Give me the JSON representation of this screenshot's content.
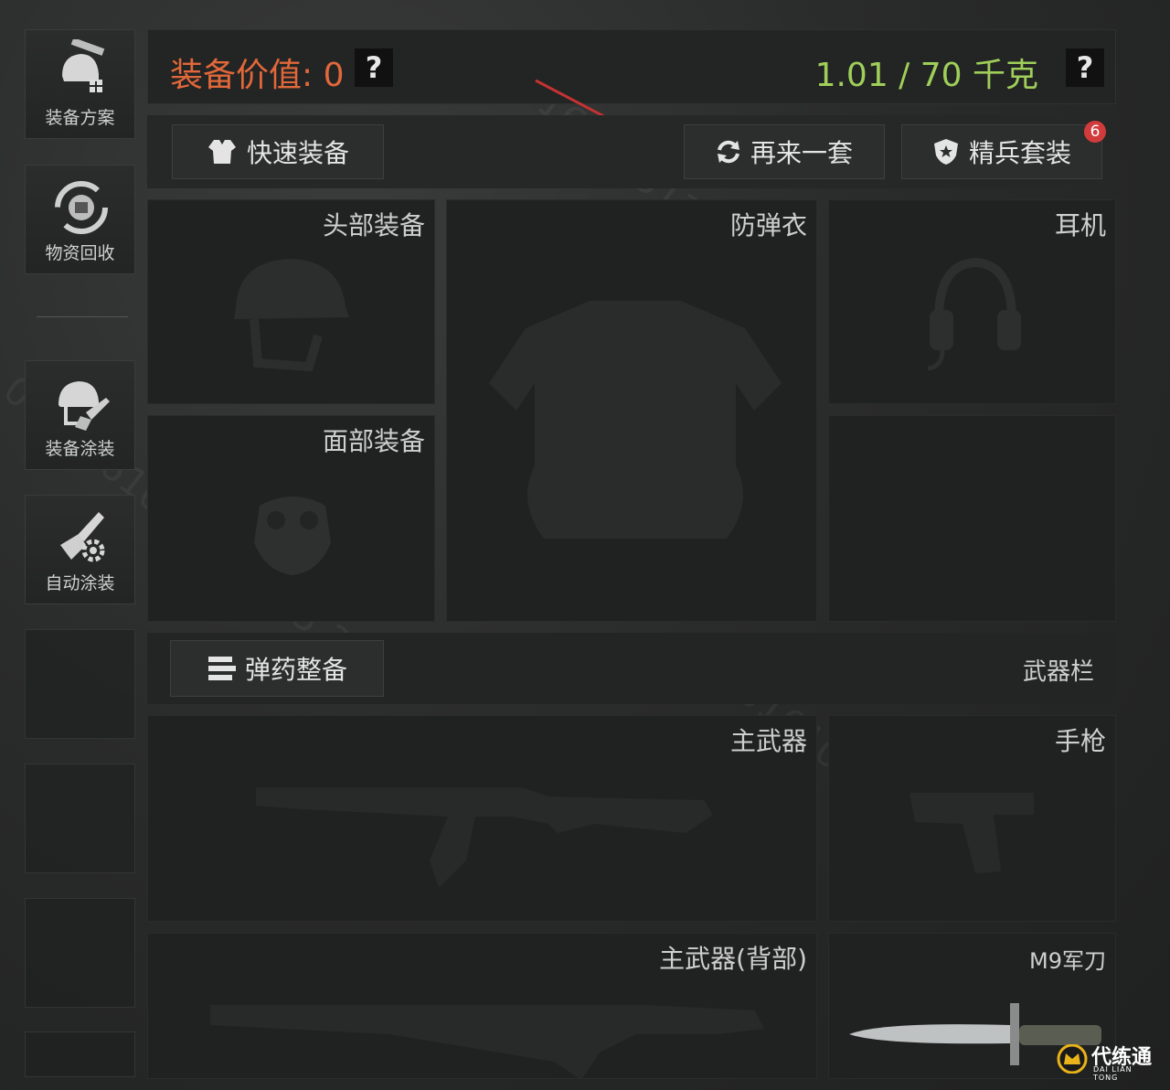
{
  "sidebar": {
    "items": [
      {
        "label": "装备方案",
        "icon": "helmet-pistol-icon"
      },
      {
        "label": "物资回收",
        "icon": "recycle-icon"
      },
      {
        "label": "装备涂装",
        "icon": "helmet-brush-icon"
      },
      {
        "label": "自动涂装",
        "icon": "brush-gear-icon"
      }
    ]
  },
  "status": {
    "value_label": "装备价值: 0",
    "weight_label": "1.01 / 70 千克",
    "help": "?"
  },
  "actions": {
    "quick_equip": "快速装备",
    "reroll": "再来一套",
    "elite_kit": "精兵套装",
    "elite_badge": "6"
  },
  "slots": {
    "head": "头部装备",
    "armor": "防弹衣",
    "headset": "耳机",
    "face": "面部装备",
    "primary": "主武器",
    "pistol": "手枪",
    "primary_back": "主武器(背部)",
    "knife": "M9军刀"
  },
  "weapons": {
    "ammo_button": "弹药整备",
    "bar_title": "武器栏"
  },
  "watermark": "0610161013138055 3",
  "logo": {
    "main": "代练通",
    "sub": "DAI LIAN TONG"
  },
  "colors": {
    "value": "#e0683a",
    "weight": "#9fcf5a",
    "badge": "#d23b3b"
  }
}
